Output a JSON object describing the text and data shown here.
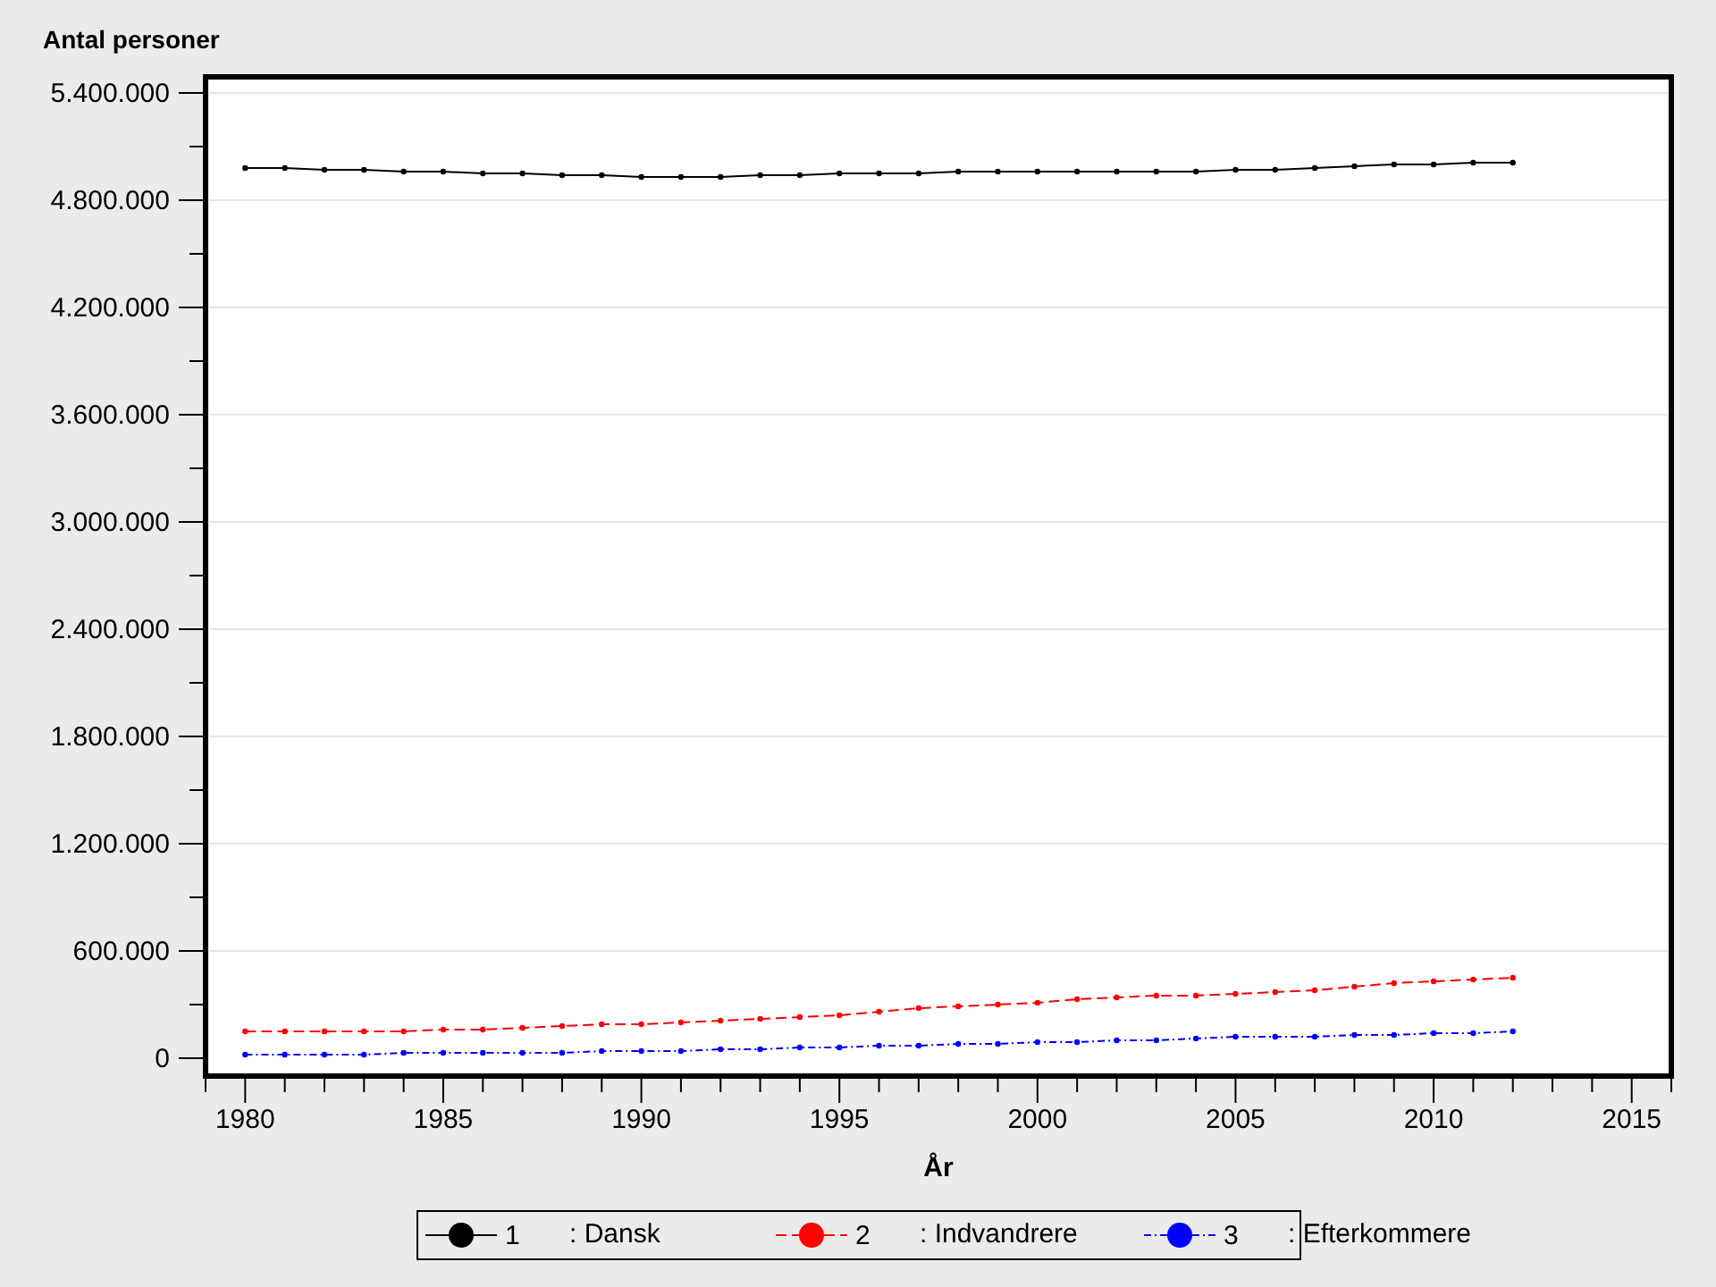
{
  "chart_data": {
    "type": "line",
    "title": "Antal personer",
    "xlabel": "År",
    "xlim": [
      1979,
      2016
    ],
    "ylim": [
      -100000,
      5490000
    ],
    "grid": true,
    "xticks": [
      1980,
      1985,
      1990,
      1995,
      2000,
      2005,
      2010,
      2015
    ],
    "yticks": [
      {
        "value": 0,
        "label": "0"
      },
      {
        "value": 600000,
        "label": "600.000"
      },
      {
        "value": 1200000,
        "label": "1.200.000"
      },
      {
        "value": 1800000,
        "label": "1.800.000"
      },
      {
        "value": 2400000,
        "label": "2.400.000"
      },
      {
        "value": 3000000,
        "label": "3.000.000"
      },
      {
        "value": 3600000,
        "label": "3.600.000"
      },
      {
        "value": 4200000,
        "label": "4.200.000"
      },
      {
        "value": 4800000,
        "label": "4.800.000"
      },
      {
        "value": 5400000,
        "label": "5.400.000"
      }
    ],
    "x": [
      1980,
      1981,
      1982,
      1983,
      1984,
      1985,
      1986,
      1987,
      1988,
      1989,
      1990,
      1991,
      1992,
      1993,
      1994,
      1995,
      1996,
      1997,
      1998,
      1999,
      2000,
      2001,
      2002,
      2003,
      2004,
      2005,
      2006,
      2007,
      2008,
      2009,
      2010,
      2011,
      2012
    ],
    "series": [
      {
        "name": "1",
        "color": "#000000",
        "line_style": "solid",
        "marker": "circle",
        "values": [
          4980000,
          4980000,
          4970000,
          4970000,
          4960000,
          4960000,
          4950000,
          4950000,
          4940000,
          4940000,
          4930000,
          4930000,
          4930000,
          4940000,
          4940000,
          4950000,
          4950000,
          4950000,
          4960000,
          4960000,
          4960000,
          4960000,
          4960000,
          4960000,
          4960000,
          4970000,
          4970000,
          4980000,
          4990000,
          5000000,
          5000000,
          5010000,
          5010000
        ]
      },
      {
        "name": "2",
        "color": "#ff0000",
        "line_style": "dashed",
        "marker": "circle",
        "values": [
          150000,
          150000,
          150000,
          150000,
          150000,
          160000,
          160000,
          170000,
          180000,
          190000,
          190000,
          200000,
          210000,
          220000,
          230000,
          240000,
          260000,
          280000,
          290000,
          300000,
          310000,
          330000,
          340000,
          350000,
          350000,
          360000,
          370000,
          380000,
          400000,
          420000,
          430000,
          440000,
          450000
        ]
      },
      {
        "name": "3",
        "color": "#0000ff",
        "line_style": "dashdot",
        "marker": "circle",
        "values": [
          20000,
          20000,
          20000,
          20000,
          30000,
          30000,
          30000,
          30000,
          30000,
          40000,
          40000,
          40000,
          50000,
          50000,
          60000,
          60000,
          70000,
          70000,
          80000,
          80000,
          90000,
          90000,
          100000,
          100000,
          110000,
          120000,
          120000,
          120000,
          130000,
          130000,
          140000,
          140000,
          150000
        ]
      }
    ]
  },
  "legend": [
    {
      "label": ": Dansk"
    },
    {
      "label": ": Indvandrere"
    },
    {
      "label": ": Efterkommere"
    }
  ]
}
